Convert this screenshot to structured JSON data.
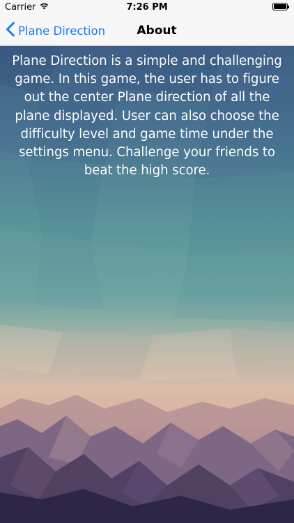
{
  "status_bar": {
    "carrier": "Carrier",
    "time": "7:26 PM",
    "icons": [
      "wifi-icon",
      "battery-icon"
    ]
  },
  "nav": {
    "back_label": "Plane Direction",
    "title": "About"
  },
  "content": {
    "about_text": "Plane Direction is a simple and challenging game. In this game, the user has to figure out the center Plane direction  of all the plane displayed. User can also choose the difficulty level and game time under the settings menu. Challenge your friends to beat the high score."
  },
  "colors": {
    "accent": "#1a7cf5",
    "background_top": "#3d5f86",
    "background_middle": "#5e9a9e",
    "background_sunset": "#e3bba6",
    "background_bottom": "#2d2647"
  }
}
